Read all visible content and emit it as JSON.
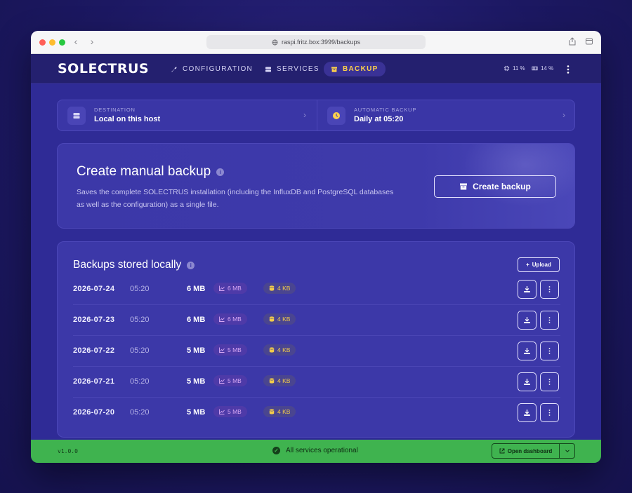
{
  "browser": {
    "url": "raspi.fritz.box:3999/backups"
  },
  "app": {
    "logo": "SOLECTRUS",
    "nav": {
      "configuration": "CONFIGURATION",
      "services": "SERVICES",
      "backup": "BACKUP"
    },
    "stats": {
      "cpu": "11 %",
      "memory": "14 %"
    }
  },
  "info": {
    "destination_label": "DESTINATION",
    "destination_value": "Local on this host",
    "auto_label": "AUTOMATIC BACKUP",
    "auto_value": "Daily at 05:20"
  },
  "create": {
    "title": "Create manual backup",
    "description": "Saves the complete SOLECTRUS installation (including the InfluxDB and PostgreSQL databases as well as the configuration) as a single file.",
    "button": "Create backup"
  },
  "list": {
    "title": "Backups stored locally",
    "upload": "Upload",
    "rows": [
      {
        "date": "2026-07-24",
        "time": "05:20",
        "size": "6 MB",
        "influx": "6 MB",
        "postgres": "4 KB"
      },
      {
        "date": "2026-07-23",
        "time": "05:20",
        "size": "6 MB",
        "influx": "6 MB",
        "postgres": "4 KB"
      },
      {
        "date": "2026-07-22",
        "time": "05:20",
        "size": "5 MB",
        "influx": "5 MB",
        "postgres": "4 KB"
      },
      {
        "date": "2026-07-21",
        "time": "05:20",
        "size": "5 MB",
        "influx": "5 MB",
        "postgres": "4 KB"
      },
      {
        "date": "2026-07-20",
        "time": "05:20",
        "size": "5 MB",
        "influx": "5 MB",
        "postgres": "4 KB"
      }
    ]
  },
  "footer": {
    "version": "v1.0.0",
    "status": "All services operational",
    "dashboard": "Open dashboard"
  },
  "colors": {
    "accent": "#ffd24a",
    "background": "#2f2b96",
    "footer": "#3fb34f"
  }
}
